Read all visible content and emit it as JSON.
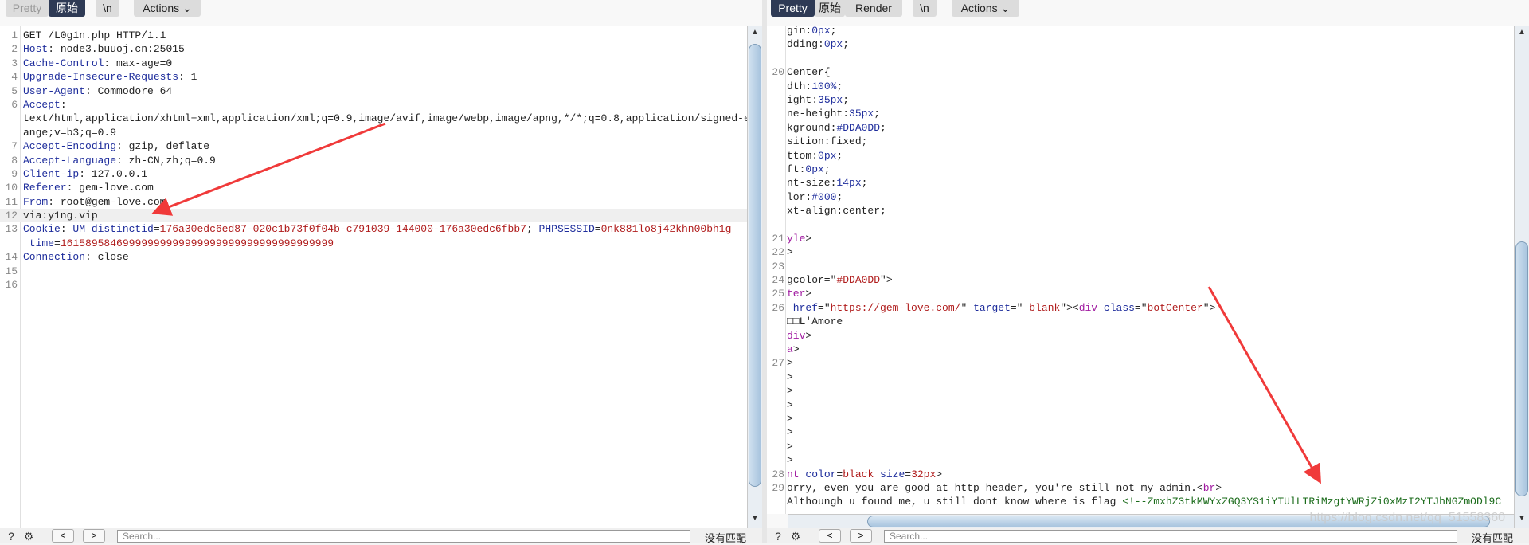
{
  "left": {
    "toolbar": {
      "pretty": "Pretty",
      "raw": "原始",
      "newline": "\\n",
      "actions": "Actions"
    },
    "lines": [
      {
        "n": "1",
        "parts": [
          [
            "v",
            "GET /L0g1n.php HTTP/1.1"
          ]
        ]
      },
      {
        "n": "2",
        "parts": [
          [
            "k",
            "Host"
          ],
          [
            "v",
            ": node3.buuoj.cn:25015"
          ]
        ]
      },
      {
        "n": "3",
        "parts": [
          [
            "k",
            "Cache-Control"
          ],
          [
            "v",
            ": max-age=0"
          ]
        ]
      },
      {
        "n": "4",
        "parts": [
          [
            "k",
            "Upgrade-Insecure-Requests"
          ],
          [
            "v",
            ": 1"
          ]
        ]
      },
      {
        "n": "5",
        "parts": [
          [
            "k",
            "User-Agent"
          ],
          [
            "v",
            ": Commodore 64"
          ]
        ]
      },
      {
        "n": "6",
        "parts": [
          [
            "k",
            "Accept"
          ],
          [
            "v",
            ":"
          ]
        ]
      },
      {
        "n": "",
        "parts": [
          [
            "v",
            "text/html,application/xhtml+xml,application/xml;q=0.9,image/avif,image/webp,image/apng,*/*;q=0.8,application/signed-exch"
          ]
        ]
      },
      {
        "n": "",
        "parts": [
          [
            "v",
            "ange;v=b3;q=0.9"
          ]
        ]
      },
      {
        "n": "7",
        "parts": [
          [
            "k",
            "Accept-Encoding"
          ],
          [
            "v",
            ": gzip, deflate"
          ]
        ]
      },
      {
        "n": "8",
        "parts": [
          [
            "k",
            "Accept-Language"
          ],
          [
            "v",
            ": zh-CN,zh;q=0.9"
          ]
        ]
      },
      {
        "n": "9",
        "parts": [
          [
            "k",
            "Client-ip"
          ],
          [
            "v",
            ": 127.0.0.1"
          ]
        ]
      },
      {
        "n": "10",
        "parts": [
          [
            "k",
            "Referer"
          ],
          [
            "v",
            ": gem-love.com"
          ]
        ]
      },
      {
        "n": "11",
        "parts": [
          [
            "k",
            "From"
          ],
          [
            "v",
            ": root@gem-love.com"
          ]
        ]
      },
      {
        "n": "12",
        "parts": [
          [
            "v",
            "via:y1ng.vip"
          ]
        ],
        "hl": true
      },
      {
        "n": "13",
        "parts": [
          [
            "k",
            "Cookie"
          ],
          [
            "v",
            ": "
          ],
          [
            "k",
            "UM_distinctid"
          ],
          [
            "v",
            "="
          ],
          [
            "r",
            "176a30edc6ed87-020c1b73f0f04b-c791039-144000-176a30edc6fbb7"
          ],
          [
            "v",
            "; "
          ],
          [
            "k",
            "PHPSESSID"
          ],
          [
            "v",
            "="
          ],
          [
            "r",
            "0nk881lo8j42khn00bh1g"
          ]
        ]
      },
      {
        "n": "",
        "parts": [
          [
            "k",
            " time"
          ],
          [
            "v",
            "="
          ],
          [
            "r",
            "16158958469999999999999999999999999999999999"
          ]
        ]
      },
      {
        "n": "14",
        "parts": [
          [
            "k",
            "Connection"
          ],
          [
            "v",
            ": close"
          ]
        ]
      },
      {
        "n": "15",
        "parts": []
      },
      {
        "n": "16",
        "parts": []
      }
    ],
    "bottom": {
      "search_placeholder": "Search...",
      "no_match": "没有匹配"
    }
  },
  "right": {
    "toolbar": {
      "pretty": "Pretty",
      "raw": "原始",
      "render": "Render",
      "newline": "\\n",
      "actions": "Actions"
    },
    "lines": [
      {
        "n": "",
        "parts": [
          [
            "v",
            "gin:"
          ],
          [
            "k",
            "0px"
          ],
          [
            "v",
            ";"
          ]
        ]
      },
      {
        "n": "",
        "parts": [
          [
            "v",
            "dding:"
          ],
          [
            "k",
            "0px"
          ],
          [
            "v",
            ";"
          ]
        ]
      },
      {
        "n": "",
        "parts": []
      },
      {
        "n": "20",
        "parts": [
          [
            "v",
            "Center{"
          ]
        ]
      },
      {
        "n": "",
        "parts": [
          [
            "v",
            "dth:"
          ],
          [
            "k",
            "100%"
          ],
          [
            "v",
            ";"
          ]
        ]
      },
      {
        "n": "",
        "parts": [
          [
            "v",
            "ight:"
          ],
          [
            "k",
            "35px"
          ],
          [
            "v",
            ";"
          ]
        ]
      },
      {
        "n": "",
        "parts": [
          [
            "v",
            "ne-height:"
          ],
          [
            "k",
            "35px"
          ],
          [
            "v",
            ";"
          ]
        ]
      },
      {
        "n": "",
        "parts": [
          [
            "v",
            "kground:"
          ],
          [
            "k",
            "#DDA0DD"
          ],
          [
            "v",
            ";"
          ]
        ]
      },
      {
        "n": "",
        "parts": [
          [
            "v",
            "sition:fixed;"
          ]
        ]
      },
      {
        "n": "",
        "parts": [
          [
            "v",
            "ttom:"
          ],
          [
            "k",
            "0px"
          ],
          [
            "v",
            ";"
          ]
        ]
      },
      {
        "n": "",
        "parts": [
          [
            "v",
            "ft:"
          ],
          [
            "k",
            "0px"
          ],
          [
            "v",
            ";"
          ]
        ]
      },
      {
        "n": "",
        "parts": [
          [
            "v",
            "nt-size:"
          ],
          [
            "k",
            "14px"
          ],
          [
            "v",
            ";"
          ]
        ]
      },
      {
        "n": "",
        "parts": [
          [
            "v",
            "lor:"
          ],
          [
            "k",
            "#000"
          ],
          [
            "v",
            ";"
          ]
        ]
      },
      {
        "n": "",
        "parts": [
          [
            "v",
            "xt-align:center;"
          ]
        ]
      },
      {
        "n": "",
        "parts": []
      },
      {
        "n": "21",
        "parts": [
          [
            "t",
            "yle"
          ],
          [
            "v",
            ">"
          ]
        ]
      },
      {
        "n": "22",
        "parts": [
          [
            "v",
            ">"
          ]
        ]
      },
      {
        "n": "23",
        "parts": []
      },
      {
        "n": "24",
        "parts": [
          [
            "v",
            "gcolor=\""
          ],
          [
            "r",
            "#DDA0DD"
          ],
          [
            "v",
            "\">"
          ]
        ]
      },
      {
        "n": "25",
        "parts": [
          [
            "t",
            "ter"
          ],
          [
            "v",
            ">"
          ]
        ]
      },
      {
        "n": "26",
        "parts": [
          [
            "k",
            " href"
          ],
          [
            "v",
            "=\""
          ],
          [
            "r",
            "https://gem-love.com/"
          ],
          [
            "v",
            "\" "
          ],
          [
            "k",
            "target"
          ],
          [
            "v",
            "=\""
          ],
          [
            "r",
            "_blank"
          ],
          [
            "v",
            "\"><"
          ],
          [
            "t",
            "div"
          ],
          [
            "k",
            " class"
          ],
          [
            "v",
            "=\""
          ],
          [
            "r",
            "botCenter"
          ],
          [
            "v",
            "\">"
          ]
        ]
      },
      {
        "n": "",
        "parts": [
          [
            "v",
            "□□L'Amore"
          ]
        ]
      },
      {
        "n": "",
        "parts": [
          [
            "t",
            "div"
          ],
          [
            "v",
            ">"
          ]
        ]
      },
      {
        "n": "",
        "parts": [
          [
            "t",
            "a"
          ],
          [
            "v",
            ">"
          ]
        ]
      },
      {
        "n": "27",
        "parts": [
          [
            "v",
            ">"
          ]
        ]
      },
      {
        "n": "",
        "parts": [
          [
            "v",
            ">"
          ]
        ]
      },
      {
        "n": "",
        "parts": [
          [
            "v",
            ">"
          ]
        ]
      },
      {
        "n": "",
        "parts": [
          [
            "v",
            ">"
          ]
        ]
      },
      {
        "n": "",
        "parts": [
          [
            "v",
            ">"
          ]
        ]
      },
      {
        "n": "",
        "parts": [
          [
            "v",
            ">"
          ]
        ]
      },
      {
        "n": "",
        "parts": [
          [
            "v",
            ">"
          ]
        ]
      },
      {
        "n": "",
        "parts": [
          [
            "v",
            ">"
          ]
        ]
      },
      {
        "n": "28",
        "parts": [
          [
            "t",
            "nt"
          ],
          [
            "k",
            " color"
          ],
          [
            "v",
            "="
          ],
          [
            "r",
            "black"
          ],
          [
            "k",
            " size"
          ],
          [
            "v",
            "="
          ],
          [
            "r",
            "32px"
          ],
          [
            "v",
            ">"
          ]
        ]
      },
      {
        "n": "29",
        "parts": [
          [
            "v",
            "orry, even you are good at http header, you're still not my admin.<"
          ],
          [
            "t",
            "br"
          ],
          [
            "v",
            ">"
          ]
        ]
      },
      {
        "n": "",
        "parts": [
          [
            "v",
            "Althoungh u found me, u still dont know where is flag "
          ],
          [
            "g",
            "<!--ZmxhZ3tkMWYxZGQ3YS1iYTUlLTRiMzgtYWRjZi0xMzI2YTJhNGZmODl9C"
          ]
        ]
      }
    ],
    "bottom": {
      "search_placeholder": "Search...",
      "no_match": "没有匹配"
    },
    "watermark": "https://blog.csdn.net/qq_51558360"
  },
  "colors": {
    "active_tab": "#2e3a55",
    "header_name": "#1e2d9c",
    "value_red": "#b01c1c",
    "tag": "#a01aa0",
    "comment": "#1a6b1a",
    "annotation_arrow": "#f03a3a"
  }
}
